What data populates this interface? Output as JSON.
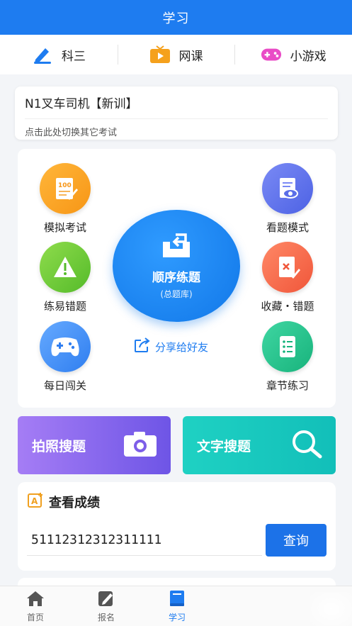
{
  "header": {
    "title": "学习"
  },
  "tabs": [
    {
      "label": "科三",
      "icon": "pen-icon"
    },
    {
      "label": "网课",
      "icon": "tv-icon"
    },
    {
      "label": "小游戏",
      "icon": "gamepad-icon"
    }
  ],
  "exam": {
    "title": "N1叉车司机【新训】",
    "subtitle": "点击此处切换其它考试"
  },
  "functions": {
    "mock_exam": "模拟考试",
    "view_mode": "看题模式",
    "error_practice": "练易错题",
    "favorites": "收藏・错题",
    "daily": "每日闯关",
    "chapter": "章节练习"
  },
  "practice": {
    "title": "顺序练题",
    "subtitle": "(总题库)"
  },
  "share": {
    "label": "分享给好友"
  },
  "search": {
    "photo": "拍照搜题",
    "text": "文字搜题"
  },
  "score": {
    "title": "查看成绩",
    "input_value": "51112312312311111",
    "button": "查询"
  },
  "bottom_nav": [
    {
      "label": "首页",
      "icon": "home-icon"
    },
    {
      "label": "报名",
      "icon": "signup-icon"
    },
    {
      "label": "学习",
      "icon": "book-icon"
    }
  ],
  "colors": {
    "primary": "#1e7cf0",
    "photo": "#8b6aee",
    "text_search": "#18c8be"
  }
}
